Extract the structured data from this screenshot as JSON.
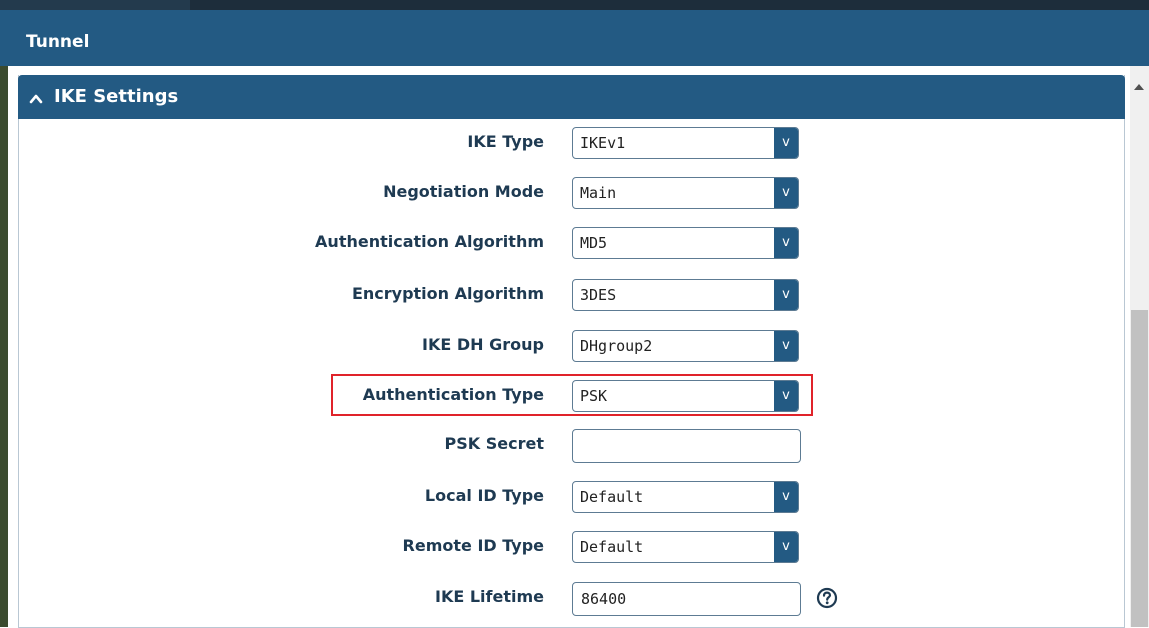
{
  "window": {
    "title": "Tunnel"
  },
  "section": {
    "title": "IKE Settings",
    "icon": "chevron-up-icon"
  },
  "fields": [
    {
      "label": "IKE Type",
      "type": "select",
      "value": "IKEv1"
    },
    {
      "label": "Negotiation Mode",
      "type": "select",
      "value": "Main"
    },
    {
      "label": "Authentication Algorithm",
      "type": "select",
      "value": "MD5"
    },
    {
      "label": "Encryption Algorithm",
      "type": "select",
      "value": "3DES"
    },
    {
      "label": "IKE DH Group",
      "type": "select",
      "value": "DHgroup2"
    },
    {
      "label": "Authentication Type",
      "type": "select",
      "value": "PSK",
      "highlighted": true
    },
    {
      "label": "PSK Secret",
      "type": "text",
      "value": ""
    },
    {
      "label": "Local ID Type",
      "type": "select",
      "value": "Default"
    },
    {
      "label": "Remote ID Type",
      "type": "select",
      "value": "Default"
    },
    {
      "label": "IKE Lifetime",
      "type": "text",
      "value": "86400",
      "help_icon": "question-circle-icon"
    }
  ],
  "select_arrow": "v",
  "colors": {
    "header_bg": "#235a83",
    "label_text": "#1e3a52",
    "highlight_border": "#e0232a",
    "input_border": "#5d7b93"
  }
}
